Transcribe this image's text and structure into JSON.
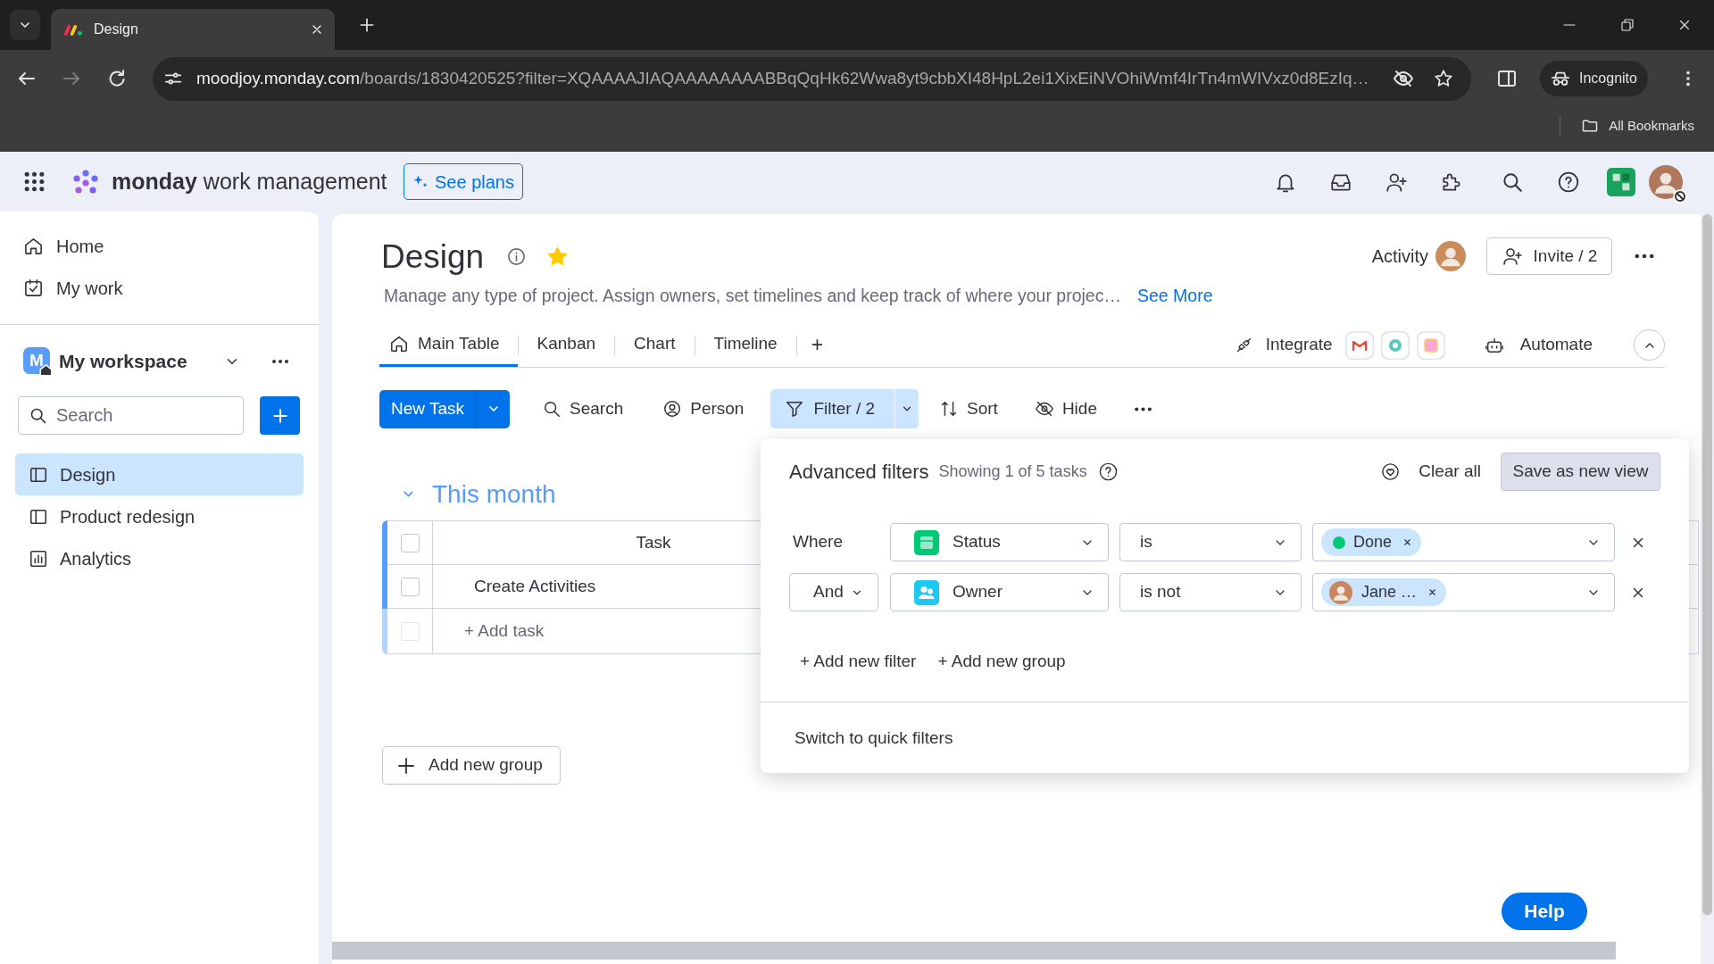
{
  "browser": {
    "tabs": [
      {
        "title": "Design",
        "selected": true
      }
    ],
    "url_host": "moodjoy.monday.com",
    "url_path": "/boards/1830420525?filter=XQAAAAJIAQAAAAAAAABBqQqHk62Wwa8yt9cbbXI48HpL2ei1XixEiNVOhiWmf4IrTn4mWIVxz0d8EzIq…",
    "profile": "Incognito",
    "bookmarks": "All Bookmarks"
  },
  "app_header": {
    "brand": "monday",
    "product": "work management",
    "plans_button": "See plans"
  },
  "sidebar": {
    "nav": [
      {
        "label": "Home",
        "kind": "home"
      },
      {
        "label": "My work",
        "kind": "my_work"
      }
    ],
    "workspace": {
      "initial": "M",
      "name": "My workspace"
    },
    "search": {
      "placeholder": "Search"
    },
    "boards": [
      {
        "label": "Design",
        "kind": "board",
        "selected": true
      },
      {
        "label": "Product redesign",
        "kind": "board",
        "selected": false
      },
      {
        "label": "Analytics",
        "kind": "dashboard",
        "selected": false
      }
    ]
  },
  "board": {
    "title": "Design",
    "starred": true,
    "description": "Manage any type of project. Assign owners, set timelines and keep track of where your projec…",
    "see_more": "See More",
    "activity": "Activity",
    "invite": "Invite / 2",
    "views": [
      {
        "label": "Main Table",
        "kind": "main",
        "selected": true
      },
      {
        "label": "Kanban",
        "kind": "view",
        "selected": false
      },
      {
        "label": "Chart",
        "kind": "view",
        "selected": false
      },
      {
        "label": "Timeline",
        "kind": "view",
        "selected": false
      }
    ],
    "add_view": "+",
    "integrate": "Integrate",
    "automate": "Automate",
    "new_task": "New Task",
    "toolbar": [
      {
        "label": "Search",
        "kind": "search",
        "active": false
      },
      {
        "label": "Person",
        "kind": "person",
        "active": false
      },
      {
        "label": "Filter / 2",
        "kind": "filter",
        "active": true
      },
      {
        "label": "Sort",
        "kind": "sort",
        "active": false
      },
      {
        "label": "Hide",
        "kind": "hide",
        "active": false
      }
    ],
    "group": {
      "title": "This month",
      "color": "#579bfc",
      "header_checked": false,
      "column": "Task",
      "rows": [
        {
          "task": "Create Activities",
          "checked": false
        }
      ],
      "add_task": "+ Add task",
      "add_row_checkbox_disabled": true
    },
    "add_group": "Add new group"
  },
  "filter_panel": {
    "title": "Advanced filters",
    "summary": "Showing 1 of 5 tasks",
    "clear_all": "Clear all",
    "save_view": "Save as new view",
    "rules": [
      {
        "conjunction": {
          "kind": "label",
          "text": "Where"
        },
        "column": {
          "kind": "status",
          "text": "Status"
        },
        "operator": "is",
        "value": {
          "kind": "status",
          "text": "Done",
          "color": "#00c875"
        }
      },
      {
        "conjunction": {
          "kind": "select",
          "text": "And"
        },
        "column": {
          "kind": "people",
          "text": "Owner"
        },
        "operator": "is not",
        "value": {
          "kind": "person",
          "text": "Jane …"
        }
      }
    ],
    "add_filter": "+ Add new filter",
    "add_group": "+ Add new group",
    "switch_link": "Switch to quick filters"
  },
  "help": "Help"
}
